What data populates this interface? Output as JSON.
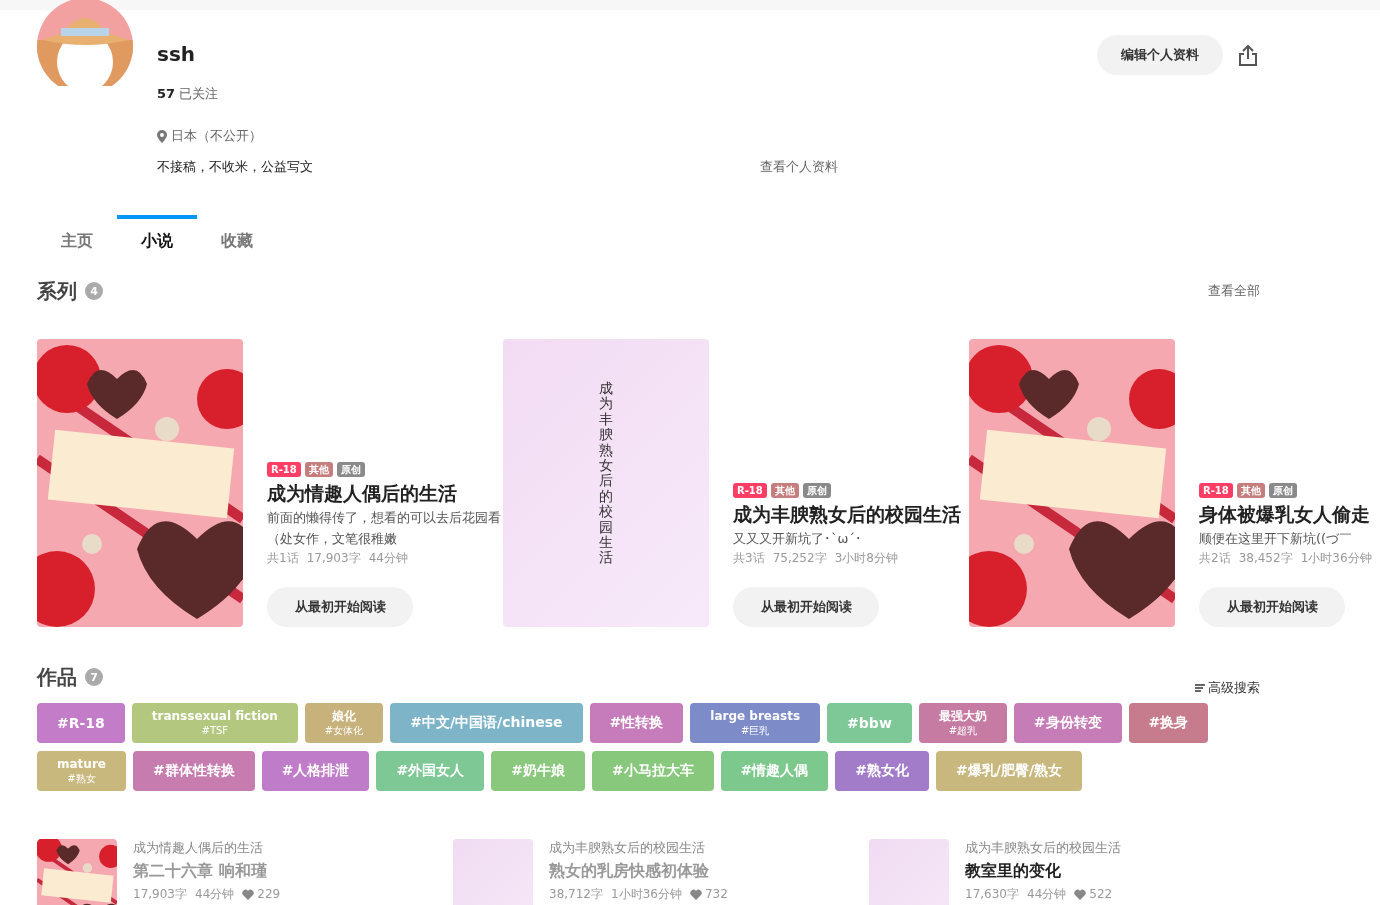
{
  "profile": {
    "name": "ssh",
    "following_count": "57",
    "following_label": "已关注",
    "location": "日本（不公开）",
    "bio": "不接稿，不收米，公益写文",
    "profile_link": "查看个人资料",
    "edit_button": "编辑个人资料"
  },
  "tabs": [
    {
      "label": "主页",
      "selected": false
    },
    {
      "label": "小说",
      "selected": true
    },
    {
      "label": "收藏",
      "selected": false
    }
  ],
  "series": {
    "title": "系列",
    "count": "4",
    "view_all": "查看全部",
    "items": [
      {
        "tags": [
          {
            "label": "R-18",
            "color": "#ff3d65"
          },
          {
            "label": "其他",
            "color": "#c57d7d"
          },
          {
            "label": "原创",
            "color": "#8a8a8a"
          }
        ],
        "title": "成为情趣人偶后的生活",
        "description": "前面的懒得传了，想看的可以去后花园看（处女作，文笔很稚嫩",
        "episodes": "共1话",
        "chars": "17,903字",
        "time": "44分钟",
        "read_button": "从最初开始阅读"
      },
      {
        "cover": {
          "kind": "text",
          "text": "成为丰腴熟女后的校园生活"
        },
        "tags": [
          {
            "label": "R-18",
            "color": "#ff3d65"
          },
          {
            "label": "其他",
            "color": "#c57d7d"
          },
          {
            "label": "原创",
            "color": "#8a8a8a"
          }
        ],
        "title": "成为丰腴熟女后的校园生活",
        "description": "又又又开新坑了･`ω´･",
        "episodes": "共3话",
        "chars": "75,252字",
        "time": "3小时8分钟",
        "read_button": "从最初开始阅读"
      },
      {
        "tags": [
          {
            "label": "R-18",
            "color": "#ff3d65"
          },
          {
            "label": "其他",
            "color": "#c57d7d"
          },
          {
            "label": "原创",
            "color": "#8a8a8a"
          }
        ],
        "title": "身体被爆乳女人偷走",
        "description": "顺便在这里开下新坑((づ￣",
        "episodes": "共2话",
        "chars": "38,452字",
        "time": "1小时36分钟",
        "read_button": "从最初开始阅读"
      }
    ]
  },
  "works": {
    "title": "作品",
    "count": "7",
    "advanced_search": "高级搜索",
    "tags": [
      {
        "label": "#R-18",
        "color": "#c27cc8"
      },
      {
        "label": "transsexual fiction",
        "translation": "#TSF",
        "color": "#b3c77f"
      },
      {
        "label": "娘化",
        "translation": "#女体化",
        "color": "#c8b27c"
      },
      {
        "label": "#中文/中国语/chinese",
        "color": "#7db4c8"
      },
      {
        "label": "#性转换",
        "color": "#c67cba"
      },
      {
        "label": "large breasts",
        "translation": "#巨乳",
        "color": "#7d8bc8"
      },
      {
        "label": "#bbw",
        "color": "#7dc896"
      },
      {
        "label": "最强大奶",
        "translation": "#超乳",
        "color": "#c67ca2"
      },
      {
        "label": "#身份转变",
        "color": "#c67cb6"
      },
      {
        "label": "#换身",
        "color": "#c67c8c"
      },
      {
        "label": "mature",
        "translation": "#熟女",
        "color": "#c8b87e"
      },
      {
        "label": "#群体性转换",
        "color": "#c77cb0"
      },
      {
        "label": "#人格排泄",
        "color": "#bf7cc8"
      },
      {
        "label": "#外国女人",
        "color": "#7dc895"
      },
      {
        "label": "#奶牛娘",
        "color": "#8ac87d"
      },
      {
        "label": "#小马拉大车",
        "color": "#88c87d"
      },
      {
        "label": "#情趣人偶",
        "color": "#7dc88c"
      },
      {
        "label": "#熟女化",
        "color": "#a27cc8"
      },
      {
        "label": "#爆乳/肥臀/熟女",
        "color": "#c8b87e"
      }
    ],
    "items": [
      {
        "series": "成为情趣人偶后的生活",
        "title": "第二十六章 响和瑾",
        "read": true,
        "chars": "17,903字",
        "time": "44分钟",
        "likes": "229"
      },
      {
        "cover": {
          "kind": "plain"
        },
        "series": "成为丰腴熟女后的校园生活",
        "title": "熟女的乳房快感初体验",
        "read": true,
        "chars": "38,712字",
        "time": "1小时36分钟",
        "likes": "732"
      },
      {
        "cover": {
          "kind": "plain"
        },
        "series": "成为丰腴熟女后的校园生活",
        "title": "教室里的变化",
        "read": false,
        "chars": "17,630字",
        "time": "44分钟",
        "likes": "522"
      }
    ]
  }
}
